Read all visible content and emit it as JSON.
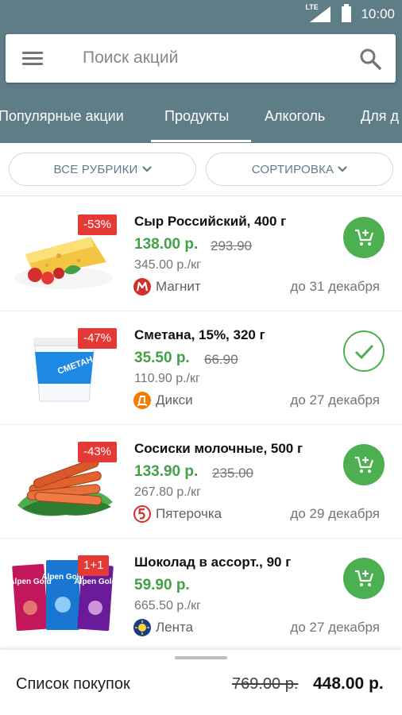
{
  "status_bar": {
    "network": "LTE",
    "time": "10:00"
  },
  "search": {
    "placeholder": "Поиск акций"
  },
  "tabs": [
    {
      "label": "Популярные акции",
      "selected": false
    },
    {
      "label": "Продукты",
      "selected": true
    },
    {
      "label": "Алкоголь",
      "selected": false
    },
    {
      "label": "Для д",
      "selected": false
    }
  ],
  "filters": {
    "categories_label": "ВСЕ РУБРИКИ",
    "sort_label": "СОРТИРОВКА"
  },
  "offers": [
    {
      "badge": "-53%",
      "title": "Сыр Российский, 400 г",
      "price": "138.00 р.",
      "old_price": "293.90",
      "unit_price": "345.00 р./кг",
      "store": "Магнит",
      "until": "до 31 декабря",
      "action": "add-to-cart"
    },
    {
      "badge": "-47%",
      "title": "Сметана, 15%, 320 г",
      "price": "35.50 р.",
      "old_price": "66.90",
      "unit_price": "110.90 р./кг",
      "store": "Дикси",
      "until": "до 27 декабря",
      "action": "added"
    },
    {
      "badge": "-43%",
      "title": "Сосиски молочные, 500 г",
      "price": "133.90 р.",
      "old_price": "235.00",
      "unit_price": "267.80 р./кг",
      "store": "Пятерочка",
      "until": "до 29 декабря",
      "action": "add-to-cart"
    },
    {
      "badge": "1+1",
      "title": "Шоколад в ассорт., 90 г",
      "price": "59.90 р.",
      "old_price": "",
      "unit_price": "665.50 р./кг",
      "store": "Лента",
      "until": "до 27 декабря",
      "action": "add-to-cart"
    }
  ],
  "product_images": {
    "cheese": "cheese wedge with tomatoes",
    "sour_cream": {
      "lid_text": "СМЕТАНА 15%"
    },
    "sausages": "sausages on lettuce",
    "chocolate": {
      "brand": "Alpen Gold"
    }
  },
  "bottom_bar": {
    "label": "Список покупок",
    "total_old": "769.00 р.",
    "total_new": "448.00 р."
  },
  "colors": {
    "header": "#5f7d87",
    "accent_green": "#4caf50",
    "price_green": "#43a047",
    "badge_red": "#e53935"
  },
  "icons": [
    "menu-icon",
    "search-icon",
    "chevron-down-icon",
    "cart-plus-icon",
    "check-icon"
  ]
}
